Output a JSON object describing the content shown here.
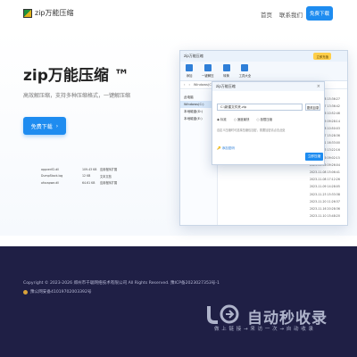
{
  "header": {
    "logo_text": "zip万能压缩",
    "nav": [
      "首页",
      "联系我们"
    ],
    "download_label": "免费下载"
  },
  "hero": {
    "title": "zip万能压缩 ™",
    "subtitle": "高效解压缩，支持多种压缩格式，一键解压缩",
    "download_label": "免费下载",
    "download_arrow": "›"
  },
  "app_window": {
    "title": "zip万能压缩",
    "title_button": "立即充值",
    "tools": [
      "添加",
      "一键解压",
      "转换",
      "工具大全"
    ],
    "sidebar": [
      "此电脑",
      "Windows(C:)",
      "本地磁盘(D:)",
      "本地磁盘(E:)"
    ],
    "dates": [
      "2023-11-08 15:36:27",
      "2023-08-07 13:36:42",
      "2023-10-16 10:52:46",
      "2023-11-05 09:28:14",
      "2023-11-08 10:50:03",
      "2023-11-07 15:28:36",
      "2023-10-01 16:33:00",
      "2023-11-23 13:22:16",
      "2023-11-16 09:02:15",
      "2023-11-06 09:26:04",
      "2023-11-08 15:06:41",
      "2023-11-08 17:12:26",
      "2023-11-09 14:28:05",
      "2023-11-23 15:33:38",
      "2023-11-20 11:26:37",
      "2023-11-16 20:28:36",
      "2023-11-10 15:48:20"
    ],
    "files": [
      {
        "name": "appverif2.dll",
        "size": "109.43 KB",
        "type": "应用程序扩展"
      },
      {
        "name": "DumpStack.log",
        "size": "12 KB",
        "type": "文本文档"
      },
      {
        "name": "ofxcapwe.dll",
        "size": "64.61 KB",
        "type": "应用程序扩展"
      }
    ]
  },
  "dialog": {
    "title": "zip万能压缩",
    "close": "×",
    "path_value": "C:\\新建文件夹.zip",
    "browse": "更改目录",
    "options": [
      "标准",
      "速度最快",
      "极限压缩"
    ],
    "note": "自定义压缩时可选择压缩包加密，需要加密请点击此处",
    "password": "添加密码",
    "go_button": "立即压缩"
  },
  "footer": {
    "copyright": "Copyright © 2023-2026 郑州市千聪网络技术有限公司 All Rights Reserved. 豫ICP备2023027353号-1",
    "police": "豫公网安备41019702003392号"
  },
  "watermark": {
    "title": "自动秒收录",
    "subtitle": "做 上 链 接 → 来 访 一 次 → 自 动 收 录"
  },
  "colors": {
    "accent": "#1e8cf0",
    "footer_bg": "#1f1f45"
  }
}
